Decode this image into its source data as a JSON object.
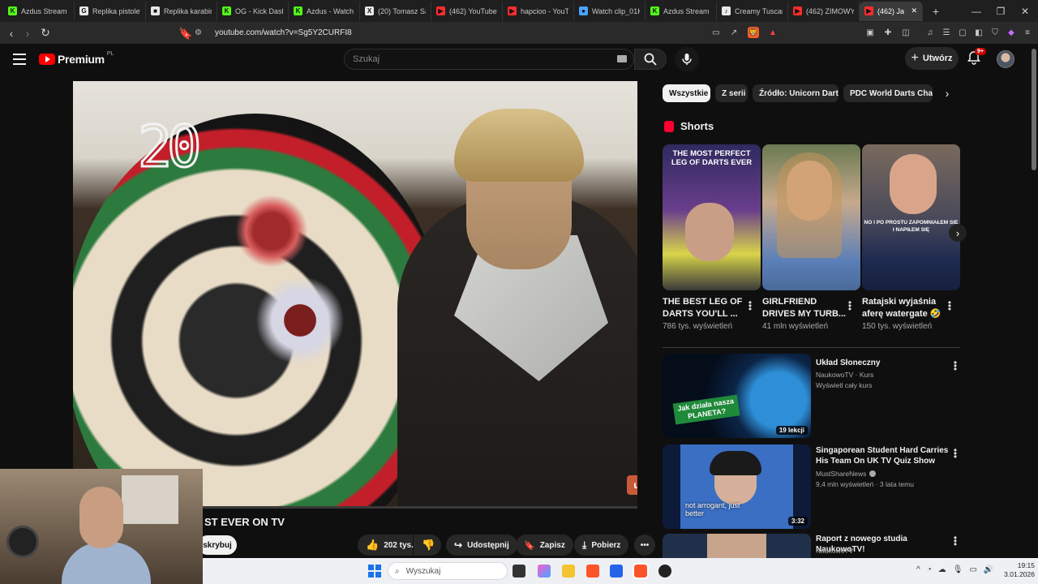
{
  "browser": {
    "tabs": [
      {
        "title": "Azdus Stream -",
        "fav": "K",
        "color": "#53fc18"
      },
      {
        "title": "Replika pistolet",
        "fav": "G",
        "color": "#e8e8e8"
      },
      {
        "title": "Replika karabin",
        "fav": "■",
        "color": "#e8e8e8"
      },
      {
        "title": "OG - Kick Dash",
        "fav": "K",
        "color": "#53fc18"
      },
      {
        "title": "Azdus - Watch",
        "fav": "K",
        "color": "#53fc18"
      },
      {
        "title": "(20) Tomasz Sa",
        "fav": "X",
        "color": "#e8e8e8"
      },
      {
        "title": "(462) YouTube",
        "fav": "▶",
        "color": "#ff2d2d"
      },
      {
        "title": "hapcioo - YouT",
        "fav": "▶",
        "color": "#ff2d2d"
      },
      {
        "title": "Watch clip_01K",
        "fav": "●",
        "color": "#4aa3ff"
      },
      {
        "title": "Azdus Stream",
        "fav": "K",
        "color": "#53fc18"
      },
      {
        "title": "Creamy Tuscan",
        "fav": "♪",
        "color": "#e8e8e8"
      },
      {
        "title": "(462) ZIMOWY",
        "fav": "▶",
        "color": "#ff2d2d"
      },
      {
        "title": "(462) Ja",
        "fav": "▶",
        "color": "#ff2d2d",
        "active": true
      }
    ],
    "url": "youtube.com/watch?v=Sg5Y2CURFI8"
  },
  "header": {
    "logo_text": "Premium",
    "region": "PL",
    "search_placeholder": "Szukaj",
    "create_label": "Utwórz",
    "notif_badge": "9+"
  },
  "video": {
    "title_fragment": "ST EVER ON TV",
    "subscribe_fragment": "skrybuj",
    "scoreboard_number": "20",
    "likes": "202 tys.",
    "share_label": "Udostępnij",
    "save_label": "Zapisz",
    "download_label": "Pobierz"
  },
  "chips": [
    "Wszystkie",
    "Z serii",
    "Źródło: Unicorn Darts",
    "PDC World Darts Champ"
  ],
  "shorts": {
    "heading": "Shorts",
    "items": [
      {
        "title": "THE BEST LEG OF DARTS YOU'LL ...",
        "views": "786 tys. wyświetleń",
        "overlay": "THE MOST PERFECT LEG OF DARTS EVER"
      },
      {
        "title": "GIRLFRIEND DRIVES MY TURB...",
        "views": "41 mln wyświetleń",
        "overlay": ""
      },
      {
        "title": "Ratajski wyjaśnia aferę watergate 🤣",
        "views": "150 tys. wyświetleń",
        "overlay": "NO I PO PROSTU ZAPOMNIAŁEM SIĘ I NAPIŁEM SIĘ"
      }
    ]
  },
  "recommendations": [
    {
      "title": "Układ Słoneczny",
      "channel": "NaukowoTV · Kurs",
      "meta": "Wyświetl cały kurs",
      "badge": "19 lekcji",
      "thumb_text": "Jak działa nasza PLANETA?"
    },
    {
      "title": "Singaporean Student Hard Carries His Team On UK TV Quiz Show",
      "channel": "MustShareNews",
      "meta": "9,4 mln wyświetleń · 3 lata temu",
      "badge": "3:32",
      "thumb_text": "not arrogant, just better"
    },
    {
      "title": "Raport z nowego studia NaukowoTV!",
      "channel": "NaukowoTV",
      "meta": "",
      "badge": "",
      "thumb_text": ""
    }
  ],
  "taskbar": {
    "search_placeholder": "Wyszukaj",
    "time": "19:15",
    "date": "3.01.2026"
  }
}
